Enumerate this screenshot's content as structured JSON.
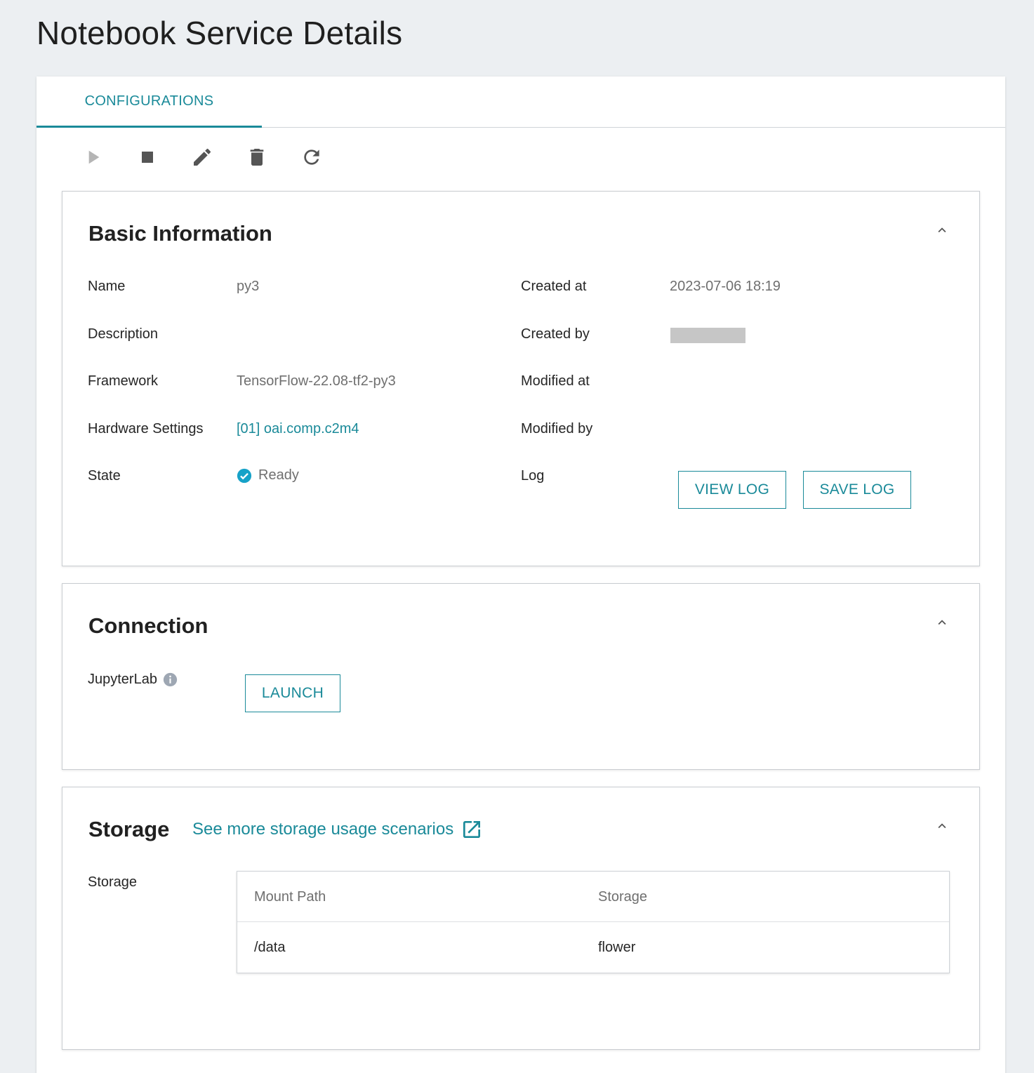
{
  "page": {
    "title": "Notebook Service Details"
  },
  "tabs": [
    {
      "label": "CONFIGURATIONS",
      "active": true
    }
  ],
  "toolbar": {
    "icons": [
      "play-icon",
      "stop-icon",
      "edit-icon",
      "delete-icon",
      "refresh-icon"
    ]
  },
  "basic_info": {
    "title": "Basic Information",
    "name_label": "Name",
    "name_value": "py3",
    "description_label": "Description",
    "description_value": "",
    "framework_label": "Framework",
    "framework_value": "TensorFlow-22.08-tf2-py3",
    "hardware_label": "Hardware Settings",
    "hardware_value": "[01] oai.comp.c2m4",
    "state_label": "State",
    "state_value": "Ready",
    "created_at_label": "Created at",
    "created_at_value": "2023-07-06 18:19",
    "created_by_label": "Created by",
    "modified_at_label": "Modified at",
    "modified_by_label": "Modified by",
    "log_label": "Log",
    "view_log_button": "VIEW LOG",
    "save_log_button": "SAVE LOG"
  },
  "connection": {
    "title": "Connection",
    "jupyter_label": "JupyterLab",
    "launch_button": "LAUNCH"
  },
  "storage": {
    "title": "Storage",
    "more_link": "See more storage usage scenarios",
    "storage_label": "Storage",
    "columns": [
      "Mount Path",
      "Storage"
    ],
    "rows": [
      {
        "mount_path": "/data",
        "storage": "flower"
      }
    ]
  },
  "colors": {
    "accent": "#1a8a99",
    "background": "#eceff2",
    "ready_check": "#17a2c8",
    "icon_disabled": "#b5b5b5",
    "icon_active": "#555555"
  }
}
